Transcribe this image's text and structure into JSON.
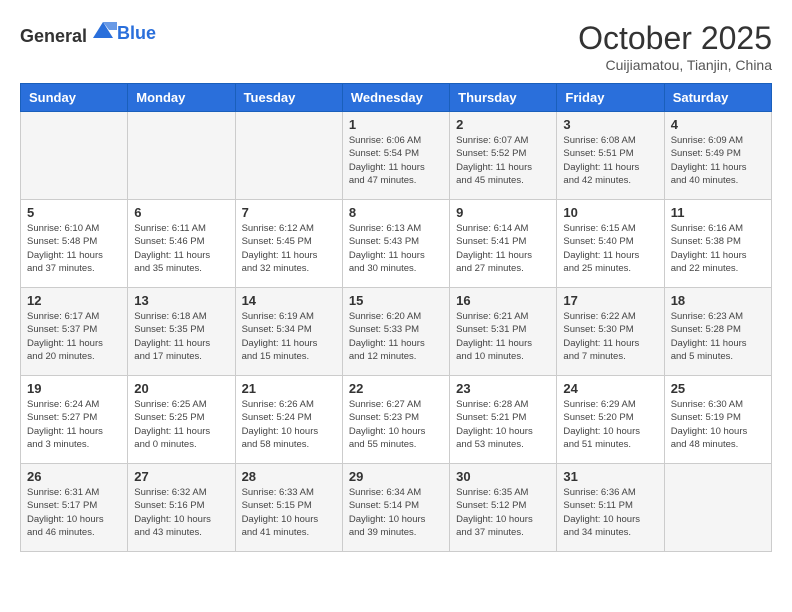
{
  "header": {
    "logo_general": "General",
    "logo_blue": "Blue",
    "month": "October 2025",
    "location": "Cuijiamatou, Tianjin, China"
  },
  "days_of_week": [
    "Sunday",
    "Monday",
    "Tuesday",
    "Wednesday",
    "Thursday",
    "Friday",
    "Saturday"
  ],
  "weeks": [
    [
      {
        "day": "",
        "sunrise": "",
        "sunset": "",
        "daylight": ""
      },
      {
        "day": "",
        "sunrise": "",
        "sunset": "",
        "daylight": ""
      },
      {
        "day": "",
        "sunrise": "",
        "sunset": "",
        "daylight": ""
      },
      {
        "day": "1",
        "sunrise": "Sunrise: 6:06 AM",
        "sunset": "Sunset: 5:54 PM",
        "daylight": "Daylight: 11 hours and 47 minutes."
      },
      {
        "day": "2",
        "sunrise": "Sunrise: 6:07 AM",
        "sunset": "Sunset: 5:52 PM",
        "daylight": "Daylight: 11 hours and 45 minutes."
      },
      {
        "day": "3",
        "sunrise": "Sunrise: 6:08 AM",
        "sunset": "Sunset: 5:51 PM",
        "daylight": "Daylight: 11 hours and 42 minutes."
      },
      {
        "day": "4",
        "sunrise": "Sunrise: 6:09 AM",
        "sunset": "Sunset: 5:49 PM",
        "daylight": "Daylight: 11 hours and 40 minutes."
      }
    ],
    [
      {
        "day": "5",
        "sunrise": "Sunrise: 6:10 AM",
        "sunset": "Sunset: 5:48 PM",
        "daylight": "Daylight: 11 hours and 37 minutes."
      },
      {
        "day": "6",
        "sunrise": "Sunrise: 6:11 AM",
        "sunset": "Sunset: 5:46 PM",
        "daylight": "Daylight: 11 hours and 35 minutes."
      },
      {
        "day": "7",
        "sunrise": "Sunrise: 6:12 AM",
        "sunset": "Sunset: 5:45 PM",
        "daylight": "Daylight: 11 hours and 32 minutes."
      },
      {
        "day": "8",
        "sunrise": "Sunrise: 6:13 AM",
        "sunset": "Sunset: 5:43 PM",
        "daylight": "Daylight: 11 hours and 30 minutes."
      },
      {
        "day": "9",
        "sunrise": "Sunrise: 6:14 AM",
        "sunset": "Sunset: 5:41 PM",
        "daylight": "Daylight: 11 hours and 27 minutes."
      },
      {
        "day": "10",
        "sunrise": "Sunrise: 6:15 AM",
        "sunset": "Sunset: 5:40 PM",
        "daylight": "Daylight: 11 hours and 25 minutes."
      },
      {
        "day": "11",
        "sunrise": "Sunrise: 6:16 AM",
        "sunset": "Sunset: 5:38 PM",
        "daylight": "Daylight: 11 hours and 22 minutes."
      }
    ],
    [
      {
        "day": "12",
        "sunrise": "Sunrise: 6:17 AM",
        "sunset": "Sunset: 5:37 PM",
        "daylight": "Daylight: 11 hours and 20 minutes."
      },
      {
        "day": "13",
        "sunrise": "Sunrise: 6:18 AM",
        "sunset": "Sunset: 5:35 PM",
        "daylight": "Daylight: 11 hours and 17 minutes."
      },
      {
        "day": "14",
        "sunrise": "Sunrise: 6:19 AM",
        "sunset": "Sunset: 5:34 PM",
        "daylight": "Daylight: 11 hours and 15 minutes."
      },
      {
        "day": "15",
        "sunrise": "Sunrise: 6:20 AM",
        "sunset": "Sunset: 5:33 PM",
        "daylight": "Daylight: 11 hours and 12 minutes."
      },
      {
        "day": "16",
        "sunrise": "Sunrise: 6:21 AM",
        "sunset": "Sunset: 5:31 PM",
        "daylight": "Daylight: 11 hours and 10 minutes."
      },
      {
        "day": "17",
        "sunrise": "Sunrise: 6:22 AM",
        "sunset": "Sunset: 5:30 PM",
        "daylight": "Daylight: 11 hours and 7 minutes."
      },
      {
        "day": "18",
        "sunrise": "Sunrise: 6:23 AM",
        "sunset": "Sunset: 5:28 PM",
        "daylight": "Daylight: 11 hours and 5 minutes."
      }
    ],
    [
      {
        "day": "19",
        "sunrise": "Sunrise: 6:24 AM",
        "sunset": "Sunset: 5:27 PM",
        "daylight": "Daylight: 11 hours and 3 minutes."
      },
      {
        "day": "20",
        "sunrise": "Sunrise: 6:25 AM",
        "sunset": "Sunset: 5:25 PM",
        "daylight": "Daylight: 11 hours and 0 minutes."
      },
      {
        "day": "21",
        "sunrise": "Sunrise: 6:26 AM",
        "sunset": "Sunset: 5:24 PM",
        "daylight": "Daylight: 10 hours and 58 minutes."
      },
      {
        "day": "22",
        "sunrise": "Sunrise: 6:27 AM",
        "sunset": "Sunset: 5:23 PM",
        "daylight": "Daylight: 10 hours and 55 minutes."
      },
      {
        "day": "23",
        "sunrise": "Sunrise: 6:28 AM",
        "sunset": "Sunset: 5:21 PM",
        "daylight": "Daylight: 10 hours and 53 minutes."
      },
      {
        "day": "24",
        "sunrise": "Sunrise: 6:29 AM",
        "sunset": "Sunset: 5:20 PM",
        "daylight": "Daylight: 10 hours and 51 minutes."
      },
      {
        "day": "25",
        "sunrise": "Sunrise: 6:30 AM",
        "sunset": "Sunset: 5:19 PM",
        "daylight": "Daylight: 10 hours and 48 minutes."
      }
    ],
    [
      {
        "day": "26",
        "sunrise": "Sunrise: 6:31 AM",
        "sunset": "Sunset: 5:17 PM",
        "daylight": "Daylight: 10 hours and 46 minutes."
      },
      {
        "day": "27",
        "sunrise": "Sunrise: 6:32 AM",
        "sunset": "Sunset: 5:16 PM",
        "daylight": "Daylight: 10 hours and 43 minutes."
      },
      {
        "day": "28",
        "sunrise": "Sunrise: 6:33 AM",
        "sunset": "Sunset: 5:15 PM",
        "daylight": "Daylight: 10 hours and 41 minutes."
      },
      {
        "day": "29",
        "sunrise": "Sunrise: 6:34 AM",
        "sunset": "Sunset: 5:14 PM",
        "daylight": "Daylight: 10 hours and 39 minutes."
      },
      {
        "day": "30",
        "sunrise": "Sunrise: 6:35 AM",
        "sunset": "Sunset: 5:12 PM",
        "daylight": "Daylight: 10 hours and 37 minutes."
      },
      {
        "day": "31",
        "sunrise": "Sunrise: 6:36 AM",
        "sunset": "Sunset: 5:11 PM",
        "daylight": "Daylight: 10 hours and 34 minutes."
      },
      {
        "day": "",
        "sunrise": "",
        "sunset": "",
        "daylight": ""
      }
    ]
  ]
}
